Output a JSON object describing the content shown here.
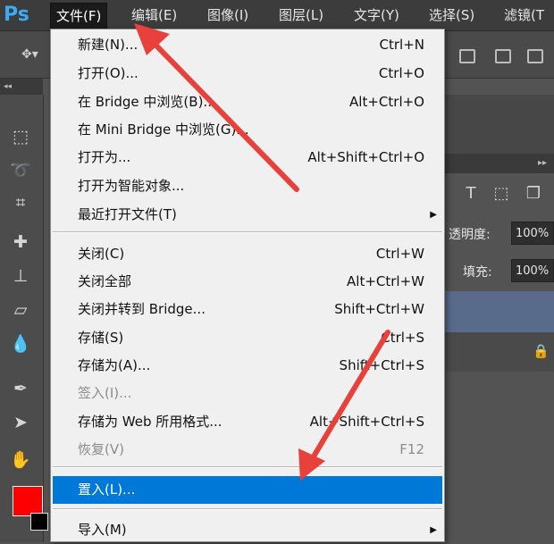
{
  "app": {
    "logo": "Ps"
  },
  "menubar": {
    "items": [
      "文件(F)",
      "编辑(E)",
      "图像(I)",
      "图层(L)",
      "文字(Y)",
      "选择(S)",
      "滤镜(T"
    ]
  },
  "file_menu": {
    "items": [
      {
        "label": "新建(N)...",
        "shortcut": "Ctrl+N"
      },
      {
        "label": "打开(O)...",
        "shortcut": "Ctrl+O"
      },
      {
        "label": "在 Bridge 中浏览(B)...",
        "shortcut": "Alt+Ctrl+O"
      },
      {
        "label": "在 Mini Bridge 中浏览(G)...",
        "shortcut": ""
      },
      {
        "label": "打开为...",
        "shortcut": "Alt+Shift+Ctrl+O"
      },
      {
        "label": "打开为智能对象...",
        "shortcut": ""
      },
      {
        "label": "最近打开文件(T)",
        "shortcut": ""
      },
      {
        "label": "关闭(C)",
        "shortcut": "Ctrl+W"
      },
      {
        "label": "关闭全部",
        "shortcut": "Alt+Ctrl+W"
      },
      {
        "label": "关闭并转到 Bridge...",
        "shortcut": "Shift+Ctrl+W"
      },
      {
        "label": "存储(S)",
        "shortcut": "Ctrl+S"
      },
      {
        "label": "存储为(A)...",
        "shortcut": "Shift+Ctrl+S"
      },
      {
        "label": "签入(I)...",
        "shortcut": ""
      },
      {
        "label": "存储为 Web 所用格式...",
        "shortcut": "Alt+Shift+Ctrl+S"
      },
      {
        "label": "恢复(V)",
        "shortcut": "F12"
      },
      {
        "label": "置入(L)...",
        "shortcut": ""
      },
      {
        "label": "导入(M)",
        "shortcut": ""
      }
    ]
  },
  "layers_panel": {
    "opacity_label": "透明度:",
    "opacity_value": "100%",
    "fill_label": "填充:",
    "fill_value": "100%"
  },
  "colors": {
    "foreground": "#ff0000",
    "background": "#000000",
    "highlight": "#0078d7",
    "annotation_arrow": "#e8403a"
  }
}
